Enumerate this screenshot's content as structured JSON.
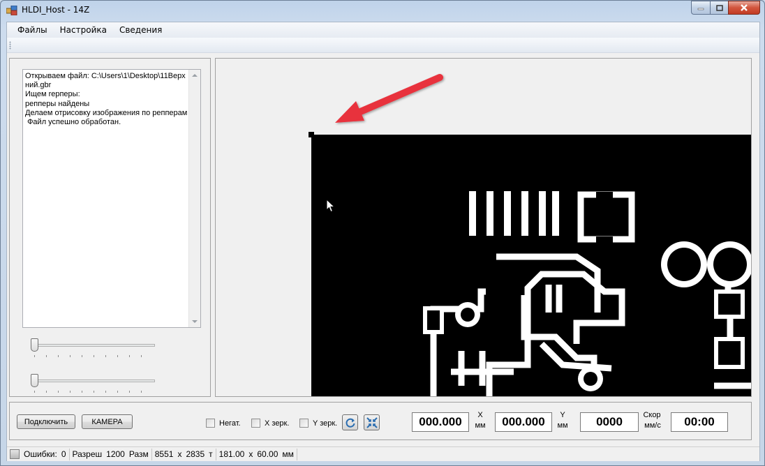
{
  "window": {
    "title": "HLDI_Host - 14Z"
  },
  "menu": {
    "items": [
      "Файлы",
      "Настройка",
      "Сведения"
    ]
  },
  "log": {
    "text": "Открываем файл: C:\\Users\\1\\Desktop\\11Верхний.gbr\nИщем repперы:\nрепперы найдены\nДелаем отрисовку изображения по репперам\n Файл успешно обработан."
  },
  "sliders": {
    "slider1_value": 0,
    "slider2_value": 0
  },
  "controls": {
    "connect_label": "Подключить",
    "camera_label": "КАМЕРА",
    "negative_label": "Негат.",
    "xmirror_label": "X зерк.",
    "ymirror_label": "Y зерк.",
    "x_value": "000.000",
    "x_axis": "X",
    "x_unit": "мм",
    "y_value": "000.000",
    "y_axis": "Y",
    "y_unit": "мм",
    "speed_value": "0000",
    "speed_label": "Скор",
    "speed_unit": "мм/с",
    "time_value": "00:00"
  },
  "status": {
    "errors_label": "Ошибки:",
    "errors_value": "0",
    "resolution_label": "Разреш",
    "resolution_value": "1200",
    "size_label": "Разм",
    "size_w": "8551",
    "size_x": "x",
    "size_h": "2835",
    "size_unit": "т",
    "dim_w": "181.00",
    "dim_x": "x",
    "dim_h": "60.00",
    "dim_unit": "мм"
  },
  "icons": {
    "app": "app-icon",
    "refresh": "refresh-icon",
    "fit": "fit-icon",
    "cursor": "cursor-icon",
    "arrow": "red-arrow-icon"
  },
  "colors": {
    "pcb_background": "#000000",
    "pcb_traces": "#ffffff",
    "annotation_arrow": "#e8323c"
  }
}
